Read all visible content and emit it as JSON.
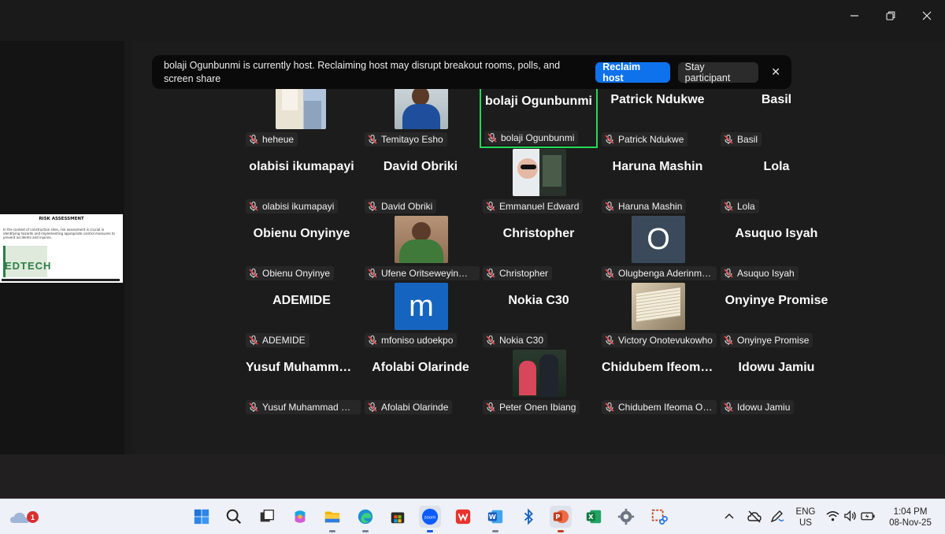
{
  "window": {
    "minimize_icon": "minimize-icon",
    "restore_icon": "restore-icon",
    "close_icon": "close-icon"
  },
  "banner": {
    "message": "bolaji Ogunbunmi is currently host. Reclaiming host may disrupt breakout rooms, polls, and screen share",
    "reclaim_label": "Reclaim host",
    "stay_label": "Stay participant",
    "close_glyph": "✕"
  },
  "share_thumbnail": {
    "title": "RISK ASSESSMENT",
    "body": "In the context of construction sites, risk assessment is crucial in identifying hazards and implementing appropriate control measures to prevent accidents and injuries.",
    "logo": "EDTECH"
  },
  "participants": [
    {
      "tile_name": "",
      "label": "heheue",
      "avatar": "photo-room"
    },
    {
      "tile_name": "",
      "label": "Temitayo Esho",
      "avatar": "photo-person-blue"
    },
    {
      "tile_name": "bolaji  Ogunbunmi",
      "label": "bolaji Ogunbunmi",
      "active": true
    },
    {
      "tile_name": "Patrick Ndukwe",
      "label": "Patrick Ndukwe"
    },
    {
      "tile_name": "Basil",
      "label": "Basil"
    },
    {
      "tile_name": "olabisi ikumapayi",
      "label": "olabisi ikumapayi"
    },
    {
      "tile_name": "David Obriki",
      "label": "David Obriki"
    },
    {
      "tile_name": "",
      "label": "Emmanuel Edward",
      "avatar": "photo-collage"
    },
    {
      "tile_name": "Haruna Mashin",
      "label": "Haruna Mashin"
    },
    {
      "tile_name": "Lola",
      "label": "Lola"
    },
    {
      "tile_name": "Obienu Onyinye",
      "label": "Obienu Onyinye"
    },
    {
      "tile_name": "",
      "label": "Ufene Oritseweyinmi L...",
      "avatar": "photo-person-green"
    },
    {
      "tile_name": "Christopher",
      "label": "Christopher"
    },
    {
      "tile_name": "",
      "label": "Olugbenga Aderinmoye",
      "avatar": "letter",
      "letter": "O",
      "avatar_color": "#3b4a5a"
    },
    {
      "tile_name": "Asuquo Isyah",
      "label": "Asuquo Isyah"
    },
    {
      "tile_name": "ADEMIDE",
      "label": "ADEMIDE"
    },
    {
      "tile_name": "",
      "label": "mfoniso udoekpo",
      "avatar": "letter",
      "letter": "m",
      "avatar_color": "#1565c0"
    },
    {
      "tile_name": "Nokia C30",
      "label": "Nokia C30"
    },
    {
      "tile_name": "",
      "label": "Victory Onotevukowho",
      "avatar": "photo-book"
    },
    {
      "tile_name": "Onyinye Promise",
      "label": "Onyinye Promise"
    },
    {
      "tile_name": "Yusuf  Muhammad Sani",
      "label": "Yusuf Muhammad Sani"
    },
    {
      "tile_name": "Afolabi Olarinde",
      "label": "Afolabi Olarinde"
    },
    {
      "tile_name": "",
      "label": "Peter Onen Ibiang",
      "avatar": "photo-couple"
    },
    {
      "tile_name": "Chidubem  Ifeoma Okafor",
      "label": "Chidubem Ifeoma Oka..."
    },
    {
      "tile_name": "Idowu Jamiu",
      "label": "Idowu Jamiu"
    }
  ],
  "taskbar": {
    "weather_badge": "1",
    "apps": [
      "start-icon",
      "search-icon",
      "task-view-icon",
      "copilot-icon",
      "file-explorer-icon",
      "edge-icon",
      "store-icon",
      "zoom-icon",
      "wps-icon",
      "word-icon",
      "bluetooth-icon",
      "powerpoint-icon",
      "excel-icon",
      "settings-icon",
      "snipping-tool-icon"
    ],
    "language_line1": "ENG",
    "language_line2": "US",
    "time": "1:04 PM",
    "date": "08-Nov-25"
  }
}
